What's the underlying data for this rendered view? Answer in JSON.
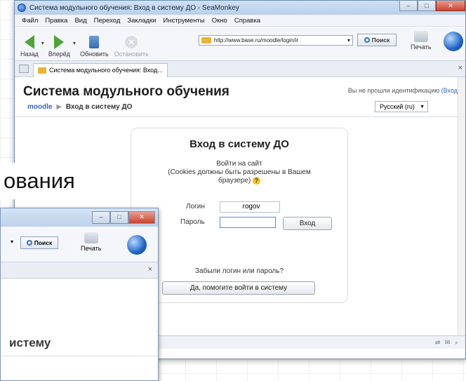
{
  "browser": {
    "window_title": "Система модульного обучения: Вход в систему ДО - SeaMonkey",
    "menu": [
      "Файл",
      "Правка",
      "Вид",
      "Переход",
      "Закладки",
      "Инструменты",
      "Окно",
      "Справка"
    ],
    "toolbar": {
      "back": "Назад",
      "forward": "Вперёд",
      "reload": "Обновить",
      "stop": "Остановить",
      "url": "http://www.base.ru/moodle/login/ir",
      "search": "Поиск",
      "print": "Печать"
    },
    "tab_title": "Система модульного обучения: Вход...",
    "tab_close": "×"
  },
  "page": {
    "title": "Система модульного обучения",
    "login_status_prefix": "Вы не прошли идентификацию",
    "login_link": "(Вход)",
    "breadcrumb": {
      "home": "moodle",
      "sep": "▶",
      "current": "Вход в систему ДО"
    },
    "language": "Русский (ru)"
  },
  "login_box": {
    "title": "Вход в систему ДО",
    "subtitle_line1": "Войти на сайт",
    "subtitle_line2": "(Cookies должны быть разрешены в Вашем",
    "subtitle_line3": "браузере)",
    "help_symbol": "?",
    "username_label": "Логин",
    "username_value": "rogov",
    "password_label": "Пароль",
    "password_value": "",
    "login_button": "Вход",
    "forgot_text": "Забыли логин или пароль?",
    "help_button": "Да, помогите войти в систему"
  },
  "second_window": {
    "search": "Поиск",
    "print": "Печать",
    "tab_close": "×",
    "heading_fragment": "истему"
  },
  "slide_text_fragment": "ования"
}
